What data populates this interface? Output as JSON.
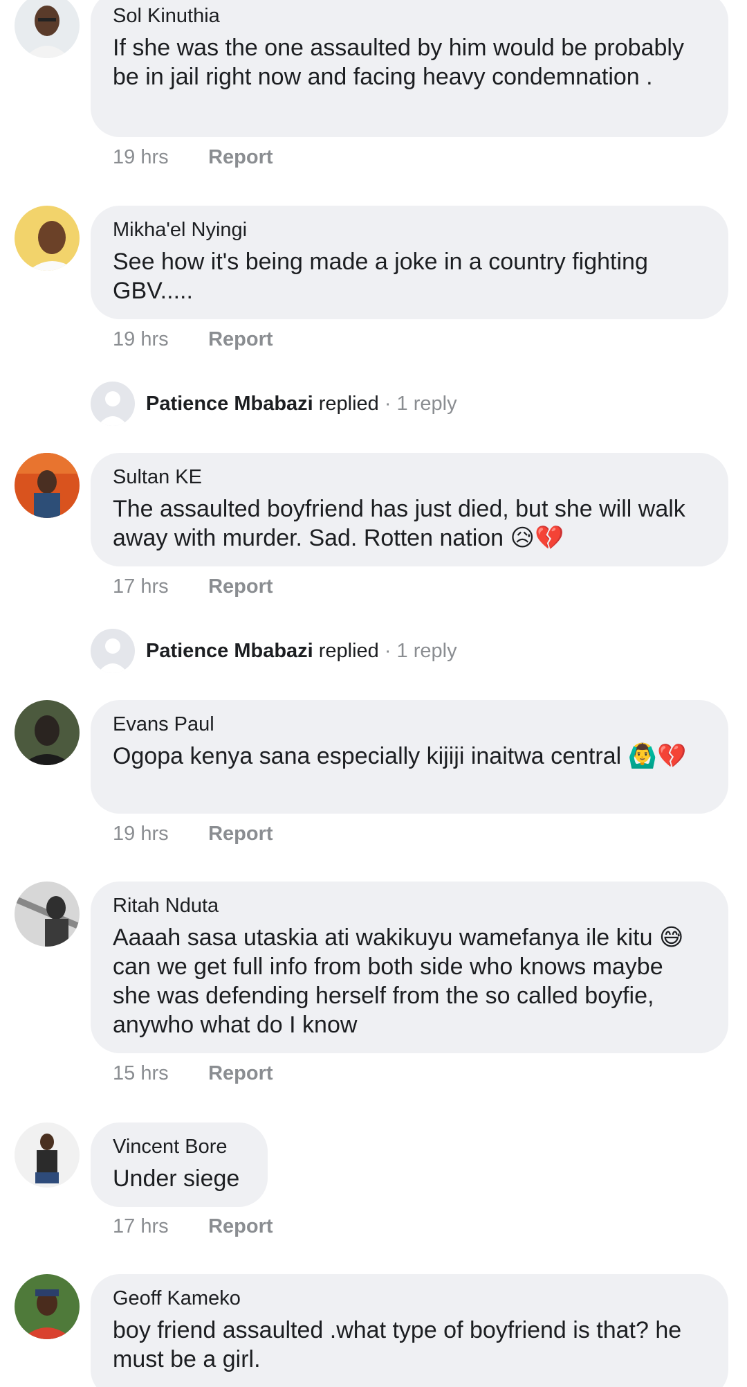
{
  "comments": [
    {
      "author": "Sol Kinuthia",
      "text": "If she was the one assaulted by him would be probably be in jail right now and facing heavy condemnation .",
      "time": "19 hrs",
      "report_label": "Report"
    },
    {
      "author": "Mikha'el Nyingi",
      "text": "See how it's being made a joke in a country fighting GBV.....",
      "time": "19 hrs",
      "report_label": "Report"
    },
    {
      "author": "Sultan KE",
      "text": "The assaulted boyfriend has just died, but she will walk away with murder. Sad. Rotten nation 😥💔",
      "time": "17 hrs",
      "report_label": "Report"
    },
    {
      "author": "Evans Paul",
      "text": "Ogopa kenya sana especially kijiji inaitwa central 🙆‍♂️💔",
      "time": "19 hrs",
      "report_label": "Report"
    },
    {
      "author": "Ritah Nduta",
      "text": "Aaaah sasa utaskia ati wakikuyu wamefanya ile kitu 😅 can we get full info from both side who knows maybe she was defending herself from the so called boyfie, anywho what do I know",
      "time": "15 hrs",
      "report_label": "Report"
    },
    {
      "author": "Vincent Bore",
      "text": "Under siege",
      "time": "17 hrs",
      "report_label": "Report"
    },
    {
      "author": "Geoff Kameko",
      "text": "boy friend assaulted .what type of boyfriend is that? he must be a girl."
    }
  ],
  "replies": [
    {
      "name": "Patience Mbabazi",
      "verb": "replied",
      "count": "· 1 reply"
    },
    {
      "name": "Patience Mbabazi",
      "verb": "replied",
      "count": "· 1 reply"
    }
  ],
  "colors": {
    "bubble": "#eff0f3",
    "meta_text": "#8a8d91",
    "primary_text": "#1c1e21"
  }
}
